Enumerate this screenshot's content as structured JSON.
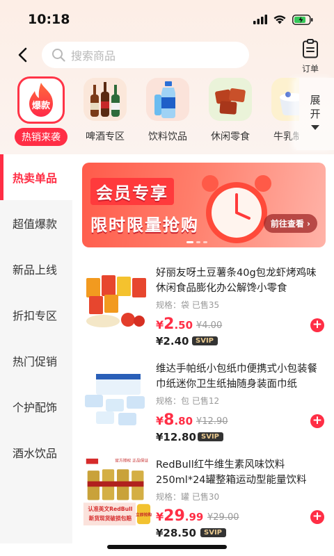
{
  "status": {
    "time": "10:18"
  },
  "header": {
    "search_placeholder": "搜索商品",
    "order_label": "订单"
  },
  "categories": [
    {
      "label": "热销来袭",
      "badge": "爆款",
      "active": true
    },
    {
      "label": "啤酒专区"
    },
    {
      "label": "饮料饮品"
    },
    {
      "label": "休闲零食"
    },
    {
      "label": "牛乳制品"
    }
  ],
  "expand_label": "展开",
  "sidebar": [
    {
      "label": "热卖单品",
      "active": true
    },
    {
      "label": "超值爆款"
    },
    {
      "label": "新品上线"
    },
    {
      "label": "折扣专区"
    },
    {
      "label": "热门促销"
    },
    {
      "label": "个护配饰"
    },
    {
      "label": "酒水饮品"
    }
  ],
  "banner": {
    "line1": "会员专享",
    "line2": "限时限量抢购",
    "cta": "前往查看 ›"
  },
  "products": [
    {
      "title": "好丽友呀土豆薯条40g包龙虾烤鸡味休闲食品膨化办公解馋小零食",
      "spec": "规格：袋 已售35",
      "price_cur": "¥",
      "price_int": "2",
      "price_dec": ".50",
      "old_price": "¥4.00",
      "svip_price": "¥2.40",
      "svip_label": "SVIP"
    },
    {
      "title": "维达手帕纸小包纸巾便携式小包装餐巾纸迷你卫生纸抽随身装面巾纸",
      "spec": "规格：包 已售12",
      "price_cur": "¥",
      "price_int": "8",
      "price_dec": ".80",
      "old_price": "¥12.90",
      "svip_price": "¥12.80",
      "svip_label": "SVIP"
    },
    {
      "title": "RedBull红牛维生素风味饮料250ml*24罐整箱运动型能量饮料",
      "spec": "规格：罐 已售30",
      "price_cur": "¥",
      "price_int": "29",
      "price_dec": ".99",
      "old_price": "¥29.00",
      "svip_price": "¥28.50",
      "svip_label": "SVIP",
      "image_text": {
        "top": "官方授权 正品保证",
        "line1": "认准英文RedBull",
        "line2": "新货现货破损包赔",
        "cta": "立即抢购"
      }
    }
  ],
  "colors": {
    "accent": "#ff2e45",
    "top_bg": "#fdeee6"
  }
}
